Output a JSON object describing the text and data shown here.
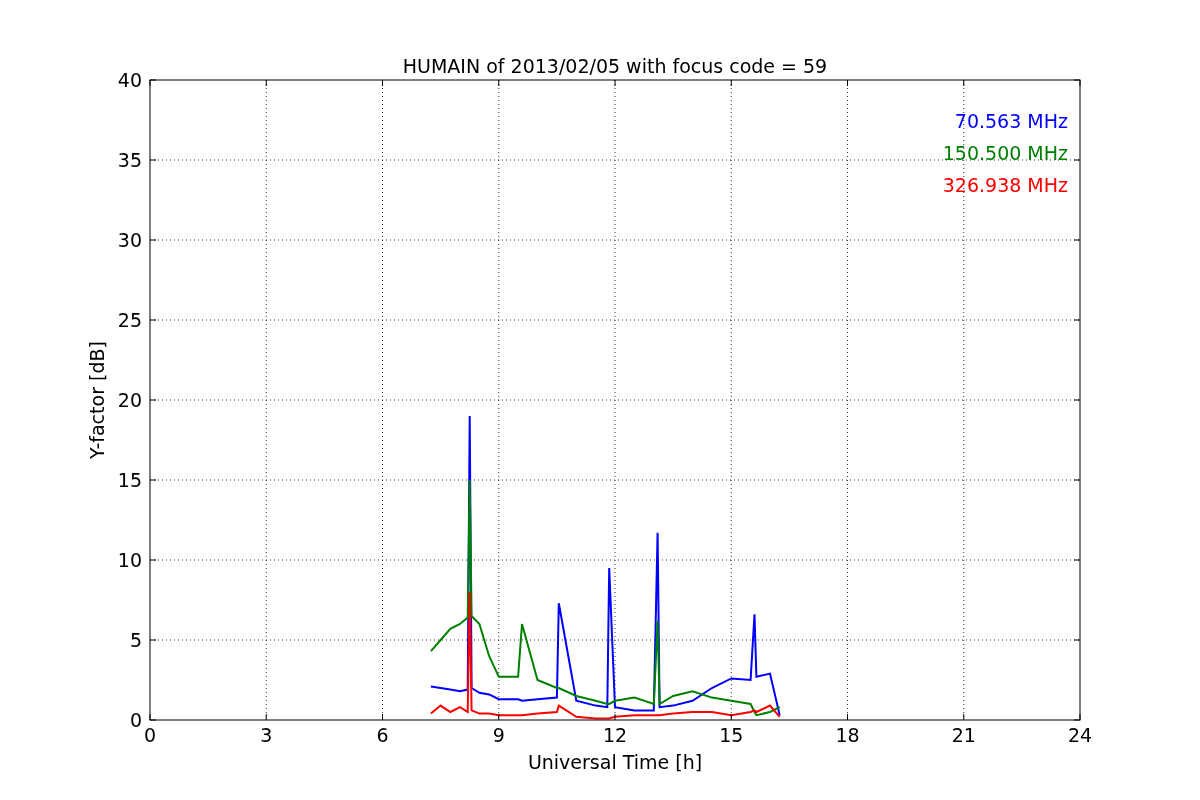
{
  "chart_data": {
    "type": "line",
    "title": "HUMAIN of 2013/02/05 with focus code = 59",
    "xlabel": "Universal Time [h]",
    "ylabel": "Y-factor [dB]",
    "x": [
      7.25,
      7.5,
      7.75,
      8.0,
      8.2,
      8.25,
      8.3,
      8.5,
      8.75,
      9.0,
      9.5,
      9.6,
      10.0,
      10.5,
      10.55,
      11.0,
      11.5,
      11.8,
      11.85,
      12.0,
      12.5,
      13.0,
      13.1,
      13.15,
      13.5,
      14.0,
      14.5,
      15.0,
      15.5,
      15.6,
      15.65,
      16.0,
      16.25
    ],
    "series": [
      {
        "name": "70.563 MHz",
        "color": "#0000ff",
        "values": [
          2.1,
          2.0,
          1.9,
          1.8,
          1.9,
          19,
          2.0,
          1.7,
          1.6,
          1.3,
          1.3,
          1.2,
          1.3,
          1.4,
          7.3,
          1.2,
          0.9,
          0.8,
          9.5,
          0.8,
          0.6,
          0.6,
          11.7,
          0.8,
          0.9,
          1.2,
          2.0,
          2.6,
          2.5,
          6.6,
          2.7,
          2.9,
          0.3
        ]
      },
      {
        "name": "150.500 MHz",
        "color": "#008000",
        "values": [
          4.3,
          5.0,
          5.7,
          6.0,
          6.4,
          15,
          6.5,
          6.0,
          4.0,
          2.7,
          2.7,
          6.0,
          2.5,
          2.0,
          2.0,
          1.5,
          1.2,
          1.0,
          1.0,
          1.2,
          1.4,
          1.0,
          6.2,
          1.0,
          1.5,
          1.8,
          1.4,
          1.2,
          1.0,
          0.5,
          0.3,
          0.5,
          0.8
        ]
      },
      {
        "name": "326.938 MHz",
        "color": "#ff0000",
        "values": [
          0.4,
          0.9,
          0.5,
          0.8,
          0.5,
          8,
          0.6,
          0.4,
          0.4,
          0.3,
          0.3,
          0.3,
          0.4,
          0.5,
          0.9,
          0.2,
          0.1,
          0.1,
          0.1,
          0.2,
          0.3,
          0.3,
          0.3,
          0.3,
          0.4,
          0.5,
          0.5,
          0.3,
          0.5,
          0.6,
          0.5,
          0.9,
          0.2
        ]
      }
    ],
    "grid": true,
    "xlim": [
      0,
      24
    ],
    "ylim": [
      0,
      40
    ],
    "xticks": [
      0,
      3,
      6,
      9,
      12,
      15,
      18,
      21,
      24
    ],
    "yticks": [
      0,
      5,
      10,
      15,
      20,
      25,
      30,
      35,
      40
    ]
  }
}
